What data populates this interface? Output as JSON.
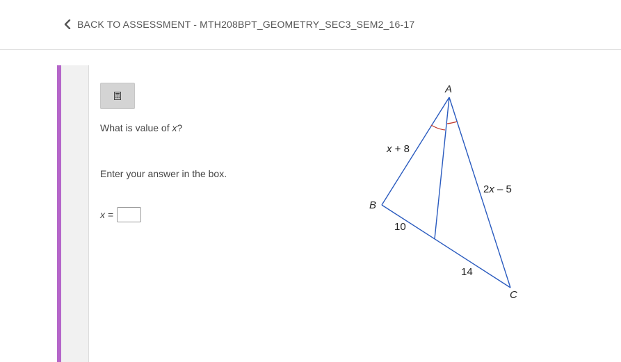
{
  "header": {
    "back_label": "BACK TO ASSESSMENT - MTH208BPT_GEOMETRY_SEC3_SEM2_16-17",
    "back_icon": "chevron-left-icon"
  },
  "toolbar": {
    "calculator_icon": "calculator-icon"
  },
  "question": {
    "prompt_before": "What is value of ",
    "prompt_var": "x",
    "prompt_after": "?",
    "instruction": "Enter your answer in the box.",
    "answer_var": "x",
    "answer_eq": "=",
    "answer_value": ""
  },
  "figure": {
    "vertex_a": "A",
    "vertex_b": "B",
    "vertex_c": "C",
    "side_ab_var": "x",
    "side_ab_rest": " + 8",
    "side_ac_coef": "2",
    "side_ac_var": "x",
    "side_ac_rest": " – 5",
    "segment_bd": "10",
    "segment_dc": "14",
    "line_color": "#2a5bbf",
    "angle_mark_color": "#c0392b"
  },
  "colors": {
    "accent": "#b566c9"
  }
}
